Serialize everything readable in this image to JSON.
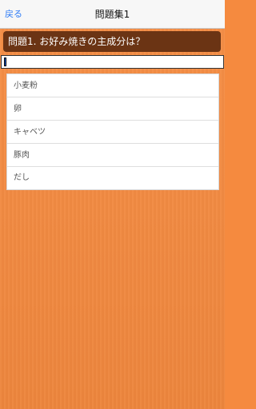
{
  "navbar": {
    "back_label": "戻る",
    "title": "問題集1"
  },
  "question": {
    "text": "問題1. お好み焼きの主成分は？"
  },
  "answer_input": {
    "value": ""
  },
  "options": [
    {
      "label": "小麦粉"
    },
    {
      "label": "卵"
    },
    {
      "label": "キャベツ"
    },
    {
      "label": "豚肉"
    },
    {
      "label": "だし"
    }
  ],
  "colors": {
    "background": "#f58a3f",
    "question_bg": "#6b3414",
    "link": "#2f7cf6"
  }
}
